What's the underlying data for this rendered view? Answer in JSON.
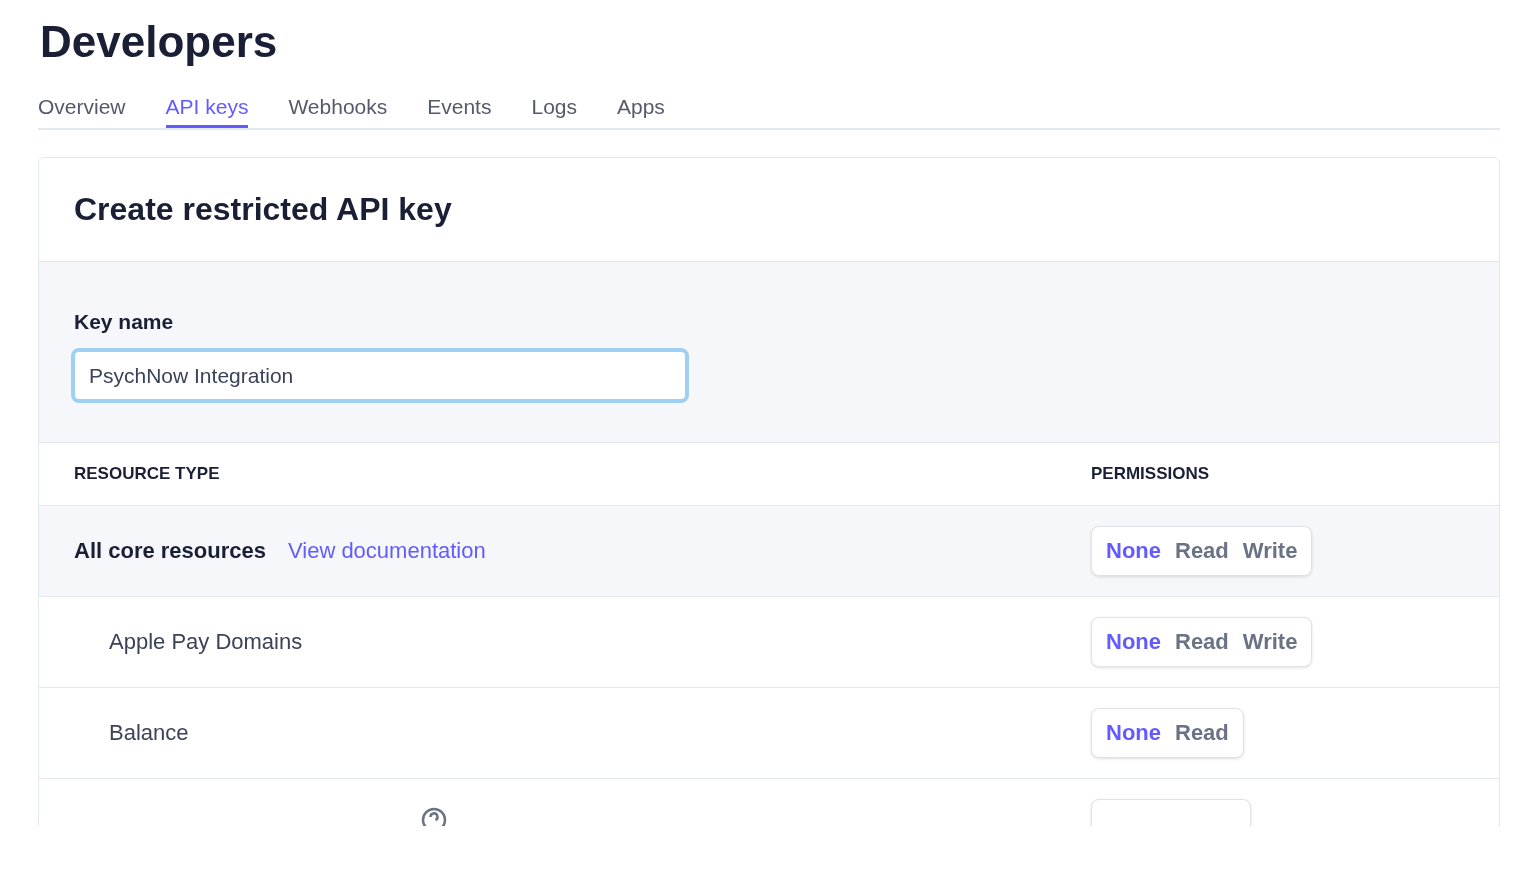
{
  "page": {
    "title": "Developers"
  },
  "tabs": [
    {
      "label": "Overview",
      "selected": false
    },
    {
      "label": "API keys",
      "selected": true
    },
    {
      "label": "Webhooks",
      "selected": false
    },
    {
      "label": "Events",
      "selected": false
    },
    {
      "label": "Logs",
      "selected": false
    },
    {
      "label": "Apps",
      "selected": false
    }
  ],
  "card": {
    "title": "Create restricted API key",
    "key_name": {
      "label": "Key name",
      "value": "PsychNow Integration",
      "focused": true
    },
    "table": {
      "columns": [
        "RESOURCE TYPE",
        "PERMISSIONS"
      ],
      "rows": [
        {
          "kind": "group",
          "name": "All core resources",
          "link": "View documentation",
          "options": [
            {
              "label": "None",
              "selected": true
            },
            {
              "label": "Read",
              "selected": false
            },
            {
              "label": "Write",
              "selected": false
            }
          ]
        },
        {
          "kind": "item",
          "name": "Apple Pay Domains",
          "options": [
            {
              "label": "None",
              "selected": true
            },
            {
              "label": "Read",
              "selected": false
            },
            {
              "label": "Write",
              "selected": false
            }
          ]
        },
        {
          "kind": "item",
          "name": "Balance",
          "options": [
            {
              "label": "None",
              "selected": true
            },
            {
              "label": "Read",
              "selected": false
            }
          ]
        },
        {
          "kind": "partial"
        }
      ]
    }
  }
}
